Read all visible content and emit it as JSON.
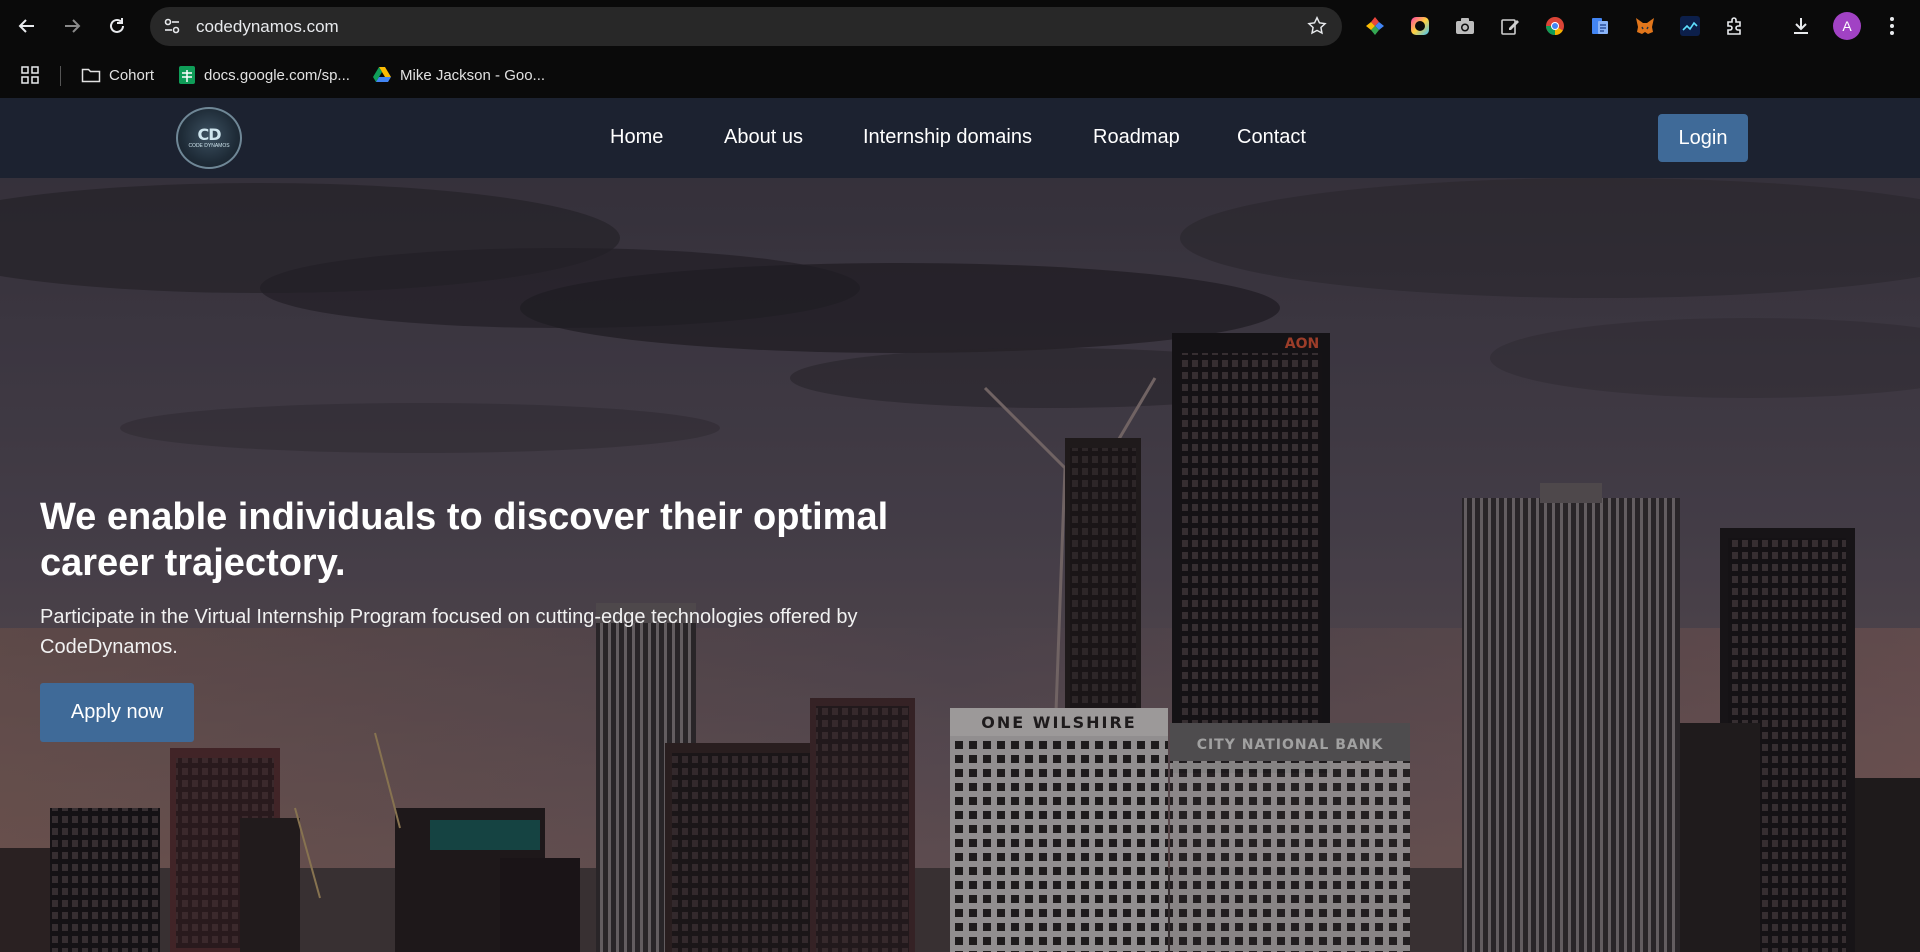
{
  "browser": {
    "url": "codedynamos.com",
    "profile_initial": "A",
    "bookmarks": [
      {
        "label": "Cohort",
        "icon": "folder-icon"
      },
      {
        "label": "docs.google.com/sp...",
        "icon": "google-sheets-icon"
      },
      {
        "label": "Mike Jackson - Goo...",
        "icon": "google-drive-icon"
      }
    ],
    "extensions": [
      "color-picker-icon",
      "gradient-ring-icon",
      "camera-icon",
      "edit-icon",
      "chrome-icon",
      "docs-icon",
      "metamask-fox-icon",
      "chart-icon",
      "puzzle-icon"
    ]
  },
  "site": {
    "logo_mono": "CD",
    "logo_text": "CODE DYNAMOS",
    "nav": [
      "Home",
      "About us",
      "Internship domains",
      "Roadmap",
      "Contact"
    ],
    "login_label": "Login"
  },
  "hero": {
    "title": "We enable individuals to discover their optimal career trajectory.",
    "subtitle": "Participate in the Virtual Internship Program focused on cutting-edge technologies offered by CodeDynamos.",
    "cta_label": "Apply now",
    "sign_one_wilshire": "ONE WILSHIRE",
    "sign_bank": "CITY NATIONAL BANK",
    "sign_aon": "AON"
  },
  "colors": {
    "header_bg": "#1c2230",
    "button_bg": "#3f6a98",
    "chrome_bg": "#0a0a0a",
    "omnibox_bg": "#282828"
  }
}
